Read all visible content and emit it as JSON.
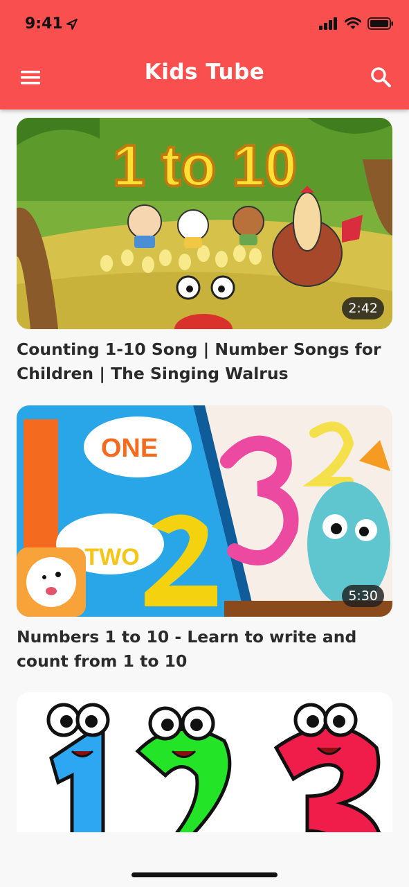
{
  "status_bar": {
    "time": "9:41"
  },
  "header": {
    "title": "Kids Tube",
    "menu_icon": "hamburger-menu-icon",
    "search_icon": "search-icon",
    "background": "#f94f4f"
  },
  "videos": [
    {
      "title": "Counting 1-10 Song | Number Songs for Children | The Singing Walrus",
      "duration": "2:42",
      "thumb_text": "1 to 10"
    },
    {
      "title": "Numbers 1 to 10 - Learn to write and count from 1 to 10",
      "duration": "5:30",
      "thumb_text_1": "ONE",
      "thumb_text_2": "TWO"
    },
    {
      "title": "",
      "duration": ""
    }
  ]
}
